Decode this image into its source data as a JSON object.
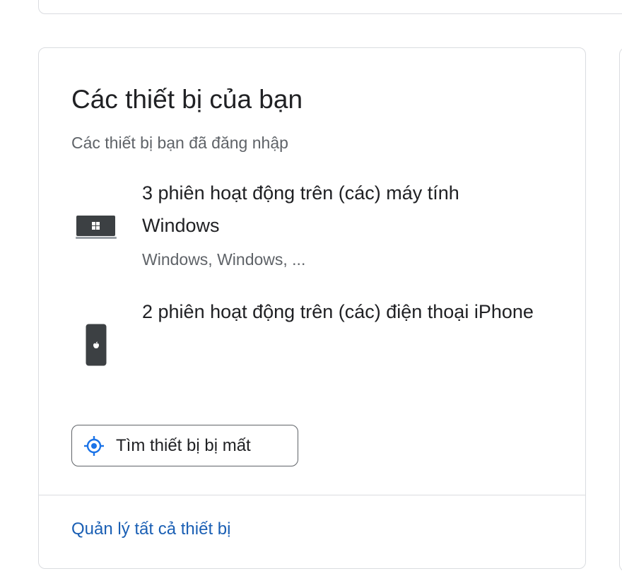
{
  "card": {
    "title": "Các thiết bị của bạn",
    "subtitle": "Các thiết bị bạn đã đăng nhập",
    "devices": [
      {
        "icon": "windows-laptop-icon",
        "title": "3 phiên hoạt động trên (các) máy tính Windows",
        "detail": "Windows, Windows, ..."
      },
      {
        "icon": "iphone-icon",
        "title": "2 phiên hoạt động trên (các) điện thoại iPhone"
      }
    ],
    "find_button": {
      "icon": "target-icon",
      "label": "Tìm thiết bị bị mất"
    },
    "manage_link": "Quản lý tất cả thiết bị"
  },
  "colors": {
    "title_text": "#202124",
    "secondary_text": "#5f6368",
    "link": "#1a5fb4",
    "accent_icon": "#1a73e8",
    "border": "#dadce0"
  }
}
